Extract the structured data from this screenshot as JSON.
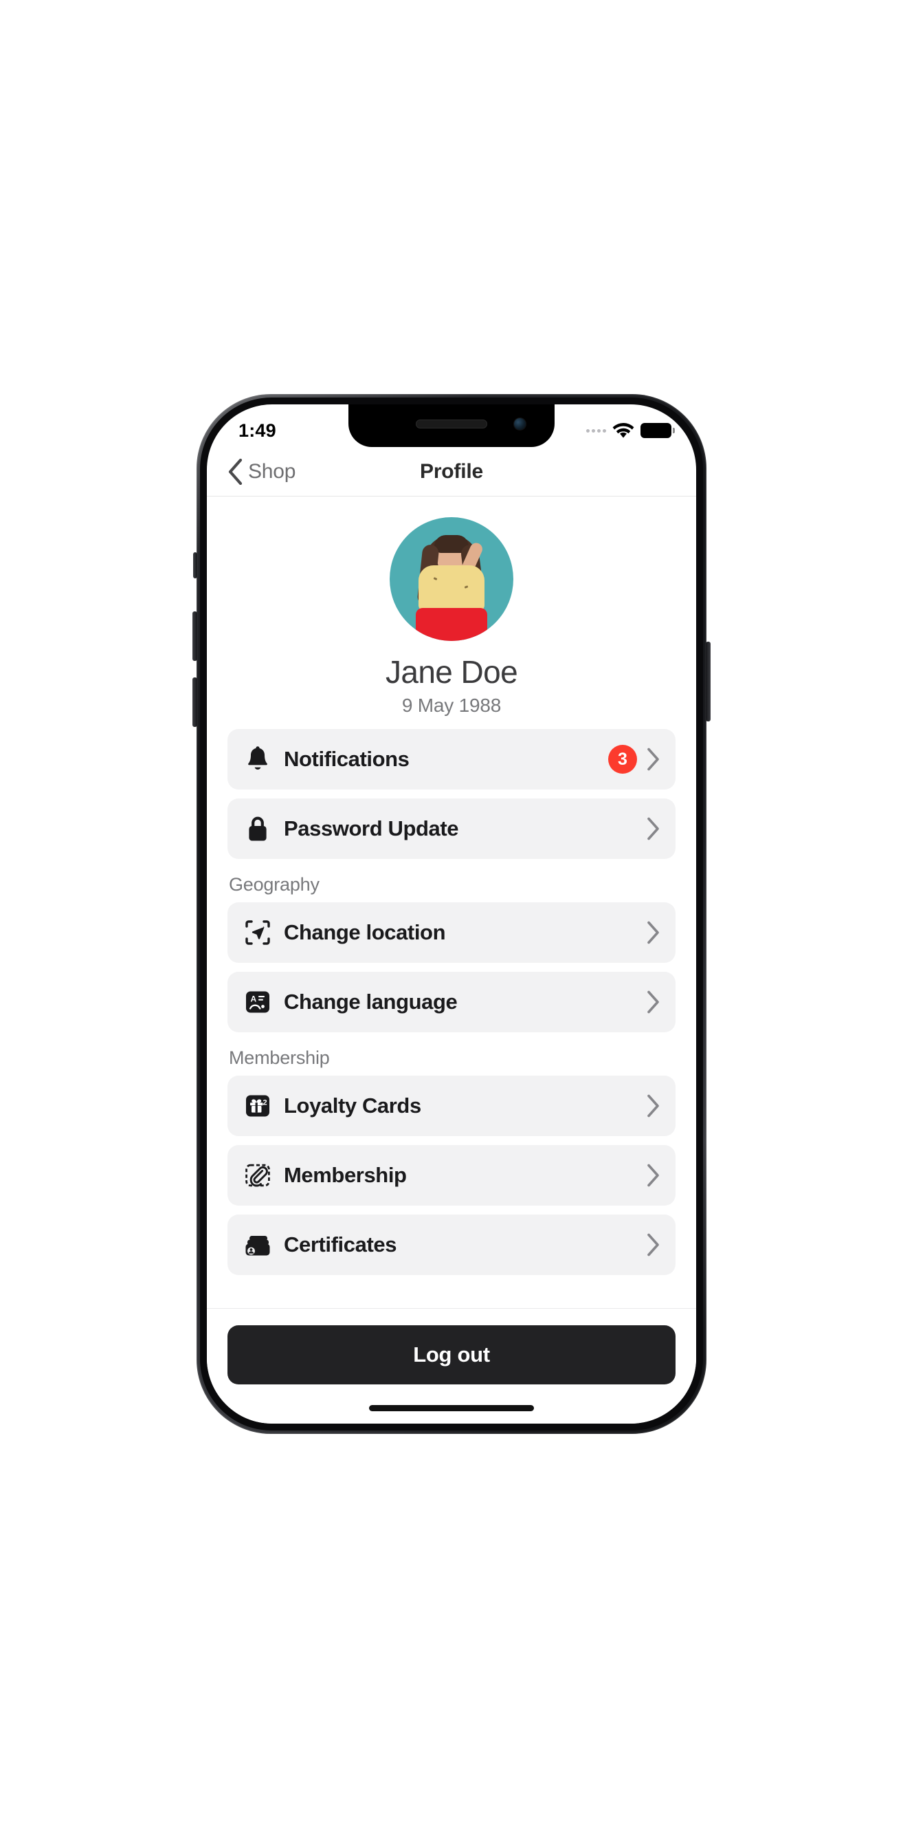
{
  "status_bar": {
    "time": "1:49",
    "signal_icon": "signal-dots-icon",
    "wifi_icon": "wifi-icon",
    "battery_icon": "battery-full-icon"
  },
  "nav": {
    "back_icon": "chevron-left-icon",
    "back_label": "Shop",
    "title": "Profile"
  },
  "profile": {
    "avatar_icon": "user-avatar-photo",
    "name": "Jane Doe",
    "birth_date": "9 May 1988"
  },
  "sections": [
    {
      "header": "",
      "items": [
        {
          "icon": "bell-icon",
          "label": "Notifications",
          "badge": "3",
          "chevron": "chevron-right-icon"
        },
        {
          "icon": "lock-icon",
          "label": "Password Update",
          "badge": "",
          "chevron": "chevron-right-icon"
        }
      ]
    },
    {
      "header": "Geography",
      "items": [
        {
          "icon": "location-arrow-icon",
          "label": "Change location",
          "badge": "",
          "chevron": "chevron-right-icon"
        },
        {
          "icon": "language-card-icon",
          "label": "Change language",
          "badge": "",
          "chevron": "chevron-right-icon"
        }
      ]
    },
    {
      "header": "Membership",
      "items": [
        {
          "icon": "gift-card-icon",
          "label": "Loyalty Cards",
          "badge": "",
          "chevron": "chevron-right-icon"
        },
        {
          "icon": "membership-card-icon",
          "label": "Membership",
          "badge": "",
          "chevron": "chevron-right-icon"
        },
        {
          "icon": "certificates-icon",
          "label": "Certificates",
          "badge": "",
          "chevron": "chevron-right-icon"
        }
      ]
    }
  ],
  "footer": {
    "logout_label": "Log out",
    "home_indicator": "home-indicator"
  },
  "colors": {
    "badge_red": "#fc3b2d",
    "row_bg": "#f2f2f3",
    "logout_bg": "#222224",
    "avatar_bg": "#4fadb2",
    "muted_text": "#77787b"
  }
}
